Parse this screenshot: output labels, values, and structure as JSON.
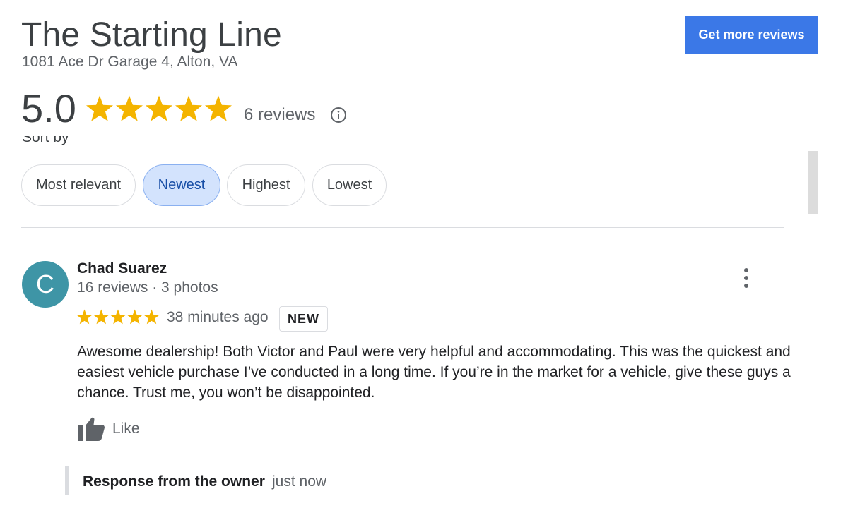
{
  "business": {
    "name": "The Starting Line",
    "address": "1081 Ace Dr Garage 4, Alton, VA"
  },
  "cta": {
    "label": "Get more reviews"
  },
  "summary": {
    "rating": "5.0",
    "stars": 5,
    "reviews_count": "6 reviews",
    "info_icon": "info-icon"
  },
  "sort": {
    "label": "Sort by",
    "options": [
      "Most relevant",
      "Newest",
      "Highest",
      "Lowest"
    ],
    "selected": "Newest"
  },
  "review": {
    "avatar_letter": "C",
    "avatar_color": "#3e95a6",
    "author": "Chad Suarez",
    "meta": "16 reviews · 3 photos",
    "stars": 5,
    "time": "38 minutes ago",
    "badge": "NEW",
    "text": "Awesome dealership!  Both Victor and Paul were very helpful and accommodating.  This was the quickest and easiest vehicle purchase I’ve conducted in a long time.  If you’re in the market for a vehicle, give these guys a chance.  Trust me, you won’t be disappointed.",
    "like_label": "Like",
    "more_icon": "more-vert-icon"
  },
  "owner_response": {
    "title": "Response from the owner",
    "time": "just now"
  },
  "colors": {
    "star": "#f4b400",
    "accent": "#3b78e7",
    "chip_selected_bg": "#d3e3fd",
    "chip_selected_text": "#174ea6"
  }
}
